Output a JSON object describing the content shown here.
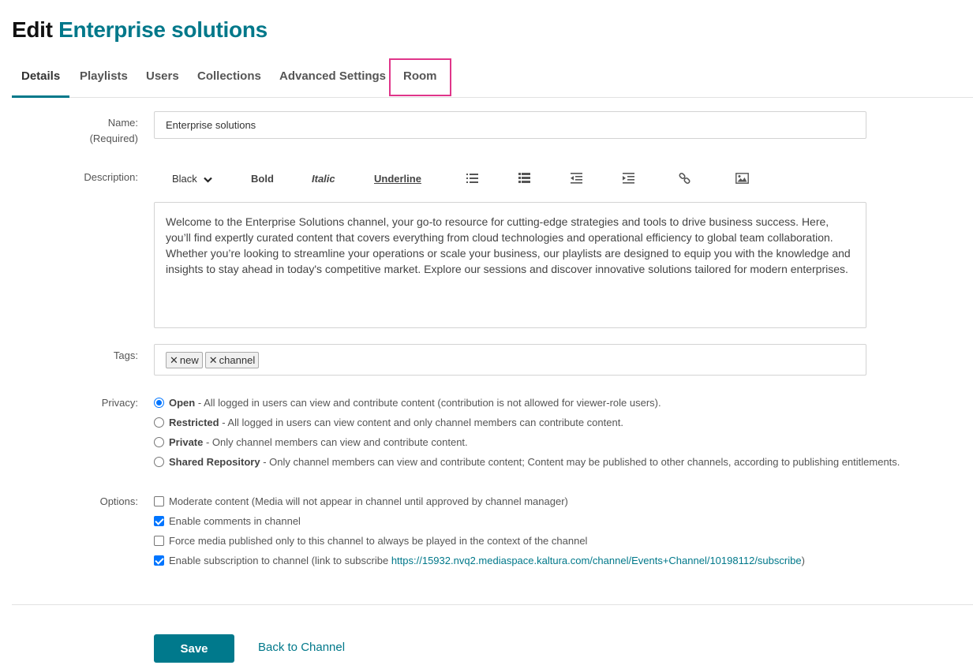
{
  "header": {
    "title_prefix": "Edit",
    "title_name": "Enterprise solutions"
  },
  "tabs": [
    {
      "label": "Details",
      "active": true
    },
    {
      "label": "Playlists"
    },
    {
      "label": "Users"
    },
    {
      "label": "Collections"
    },
    {
      "label": "Advanced Settings"
    },
    {
      "label": "Room",
      "highlighted": true
    }
  ],
  "form": {
    "name_label": "Name:",
    "name_required": "(Required)",
    "name_value": "Enterprise solutions",
    "description_label": "Description:",
    "toolbar": {
      "color_select": "Black",
      "bold": "Bold",
      "italic": "Italic",
      "underline": "Underline",
      "icons": [
        "bulleted-list-icon",
        "numbered-list-icon",
        "outdent-icon",
        "indent-icon",
        "link-icon",
        "image-icon"
      ]
    },
    "description_value": "Welcome to the Enterprise Solutions channel, your go-to resource for cutting-edge strategies and tools to drive business success. Here, you’ll find expertly curated content that covers everything from cloud technologies and operational efficiency to global team collaboration. Whether you’re looking to streamline your operations or scale your business, our playlists are designed to equip you with the knowledge and insights to stay ahead in today's competitive market. Explore our sessions and discover innovative solutions tailored for modern enterprises.",
    "tags_label": "Tags:",
    "tags": [
      "new",
      "channel"
    ],
    "privacy_label": "Privacy:",
    "privacy_options": [
      {
        "title": "Open",
        "desc": " - All logged in users can view and contribute content (contribution is not allowed for viewer-role users).",
        "selected": true
      },
      {
        "title": "Restricted",
        "desc": " - All logged in users can view content and only channel members can contribute content."
      },
      {
        "title": "Private",
        "desc": " - Only channel members can view and contribute content."
      },
      {
        "title": "Shared Repository",
        "desc": " - Only channel members can view and contribute content; Content may be published to other channels, according to publishing entitlements."
      }
    ],
    "options_label": "Options:",
    "options": [
      {
        "text": "Moderate content (Media will not appear in channel until approved by channel manager)",
        "checked": false
      },
      {
        "text": "Enable comments in channel",
        "checked": true
      },
      {
        "text": "Force media published only to this channel to always be played in the context of the channel",
        "checked": false
      },
      {
        "text": "Enable subscription to channel (link to subscribe ",
        "link": "https://15932.nvq2.mediaspace.kaltura.com/channel/Events+Channel/10198112/subscribe",
        "suffix": ")",
        "checked": true
      }
    ]
  },
  "actions": {
    "save_label": "Save",
    "back_label": "Back to Channel"
  },
  "colors": {
    "accent": "#00788a",
    "tab_highlight": "#e0358a",
    "control_blue": "#0075ff"
  }
}
